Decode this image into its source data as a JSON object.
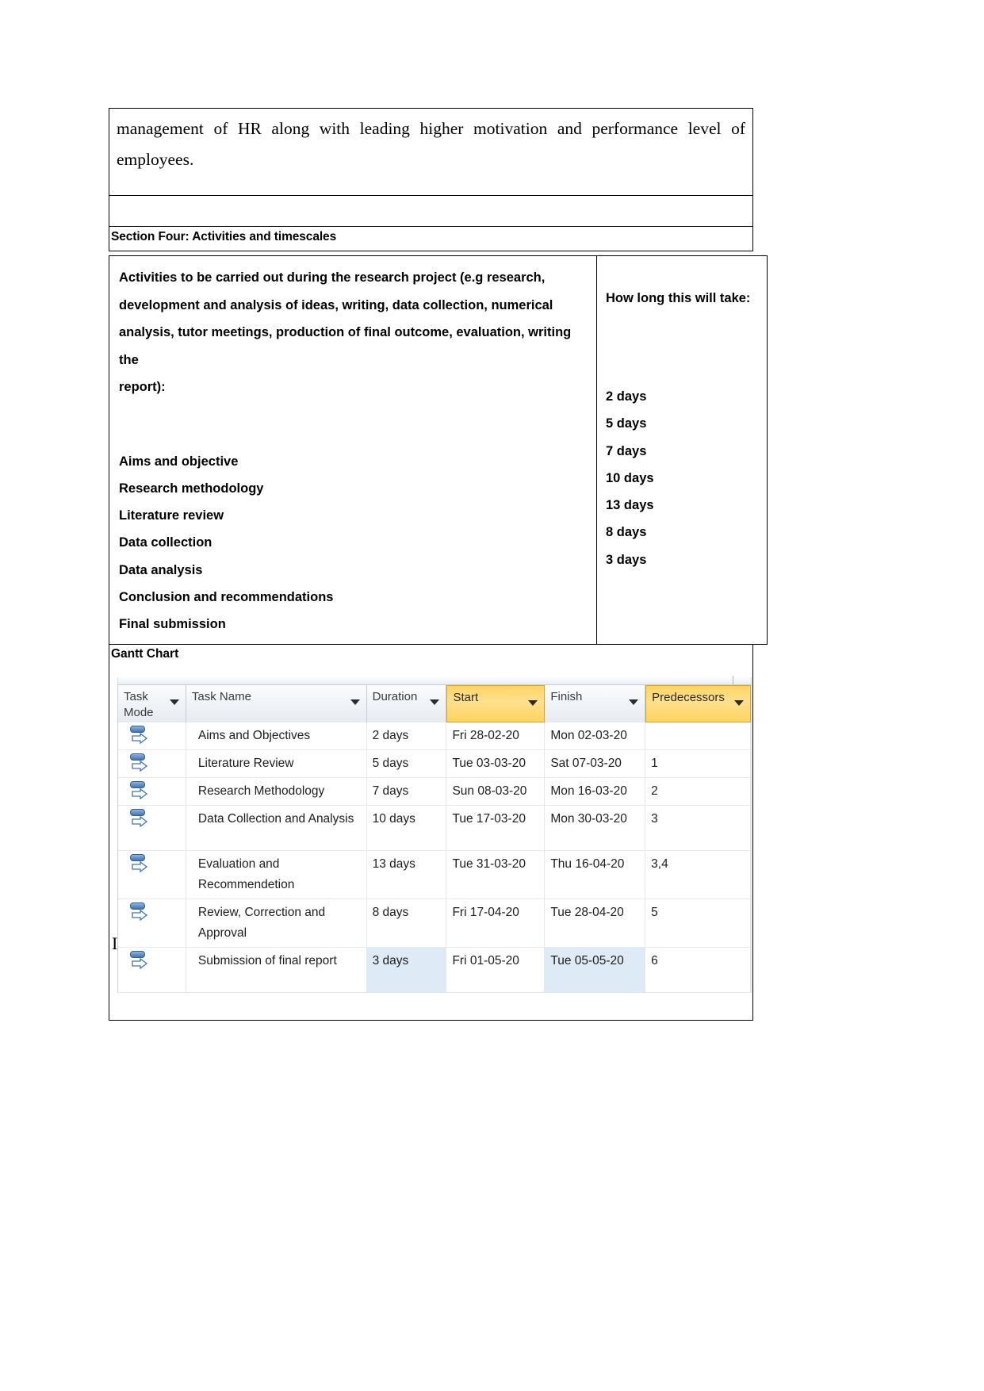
{
  "document": {
    "paragraph": "management of HR along with leading higher motivation and performance level of employees.",
    "section_heading": "Section Four: Activities and timescales",
    "gantt_label": "Gantt Chart"
  },
  "activities_table": {
    "left_header": "Activities to be carried out during the research project (e.g research, development and analysis of ideas, writing, data collection, numerical analysis, tutor meetings, production of final outcome, evaluation, writing the report):",
    "left_header_lines": [
      "Activities to be carried out during the research project (e.g research,",
      "development and analysis of ideas, writing, data collection, numerical",
      "analysis, tutor meetings, production of final outcome, evaluation, writing the",
      "report):"
    ],
    "right_header": "How long this will take:",
    "rows": [
      {
        "activity": "Aims and objective",
        "duration": "2 days"
      },
      {
        "activity": "Research methodology",
        "duration": "5 days"
      },
      {
        "activity": "Literature review",
        "duration": "7 days"
      },
      {
        "activity": "Data collection",
        "duration": "10 days"
      },
      {
        "activity": "Data analysis",
        "duration": "13 days"
      },
      {
        "activity": "Conclusion and recommendations",
        "duration": "8 days"
      },
      {
        "activity": "Final submission",
        "duration": "3 days"
      }
    ]
  },
  "gantt_grid": {
    "columns": [
      {
        "label": "Task Mode",
        "highlighted": false
      },
      {
        "label": "Task Name",
        "highlighted": false
      },
      {
        "label": "Duration",
        "highlighted": false
      },
      {
        "label": "Start",
        "highlighted": true
      },
      {
        "label": "Finish",
        "highlighted": false
      },
      {
        "label": "Predecessors",
        "highlighted": true
      }
    ],
    "highlight_color": "#ffd35c",
    "selection_color": "#dfeaf7",
    "rows": [
      {
        "task_mode": "auto-scheduled-icon",
        "task_name": "Aims and Objectives",
        "duration": "2 days",
        "start": "Fri 28-02-20",
        "finish": "Mon 02-03-20",
        "predecessors": ""
      },
      {
        "task_mode": "auto-scheduled-icon",
        "task_name": "Literature Review",
        "duration": "5 days",
        "start": "Tue 03-03-20",
        "finish": "Sat 07-03-20",
        "predecessors": "1"
      },
      {
        "task_mode": "auto-scheduled-icon",
        "task_name": "Research Methodology",
        "duration": "7 days",
        "start": "Sun 08-03-20",
        "finish": "Mon 16-03-20",
        "predecessors": "2"
      },
      {
        "task_mode": "auto-scheduled-icon",
        "task_name": "Data Collection and Analysis",
        "duration": "10 days",
        "start": "Tue 17-03-20",
        "finish": "Mon 30-03-20",
        "predecessors": "3"
      },
      {
        "task_mode": "auto-scheduled-icon",
        "task_name": "Evaluation and Recommendetion",
        "duration": "13 days",
        "start": "Tue 31-03-20",
        "finish": "Thu 16-04-20",
        "predecessors": "3,4"
      },
      {
        "task_mode": "auto-scheduled-icon",
        "task_name": "Review, Correction and Approval",
        "duration": "8 days",
        "start": "Fri 17-04-20",
        "finish": "Tue 28-04-20",
        "predecessors": "5"
      },
      {
        "task_mode": "auto-scheduled-icon",
        "task_name": "Submission of final report",
        "duration": "3 days",
        "start": "Fri 01-05-20",
        "finish": "Tue 05-05-20",
        "predecessors": "6",
        "selected_cells": [
          "duration",
          "finish"
        ]
      }
    ]
  },
  "cursor": {
    "glyph": "I"
  }
}
